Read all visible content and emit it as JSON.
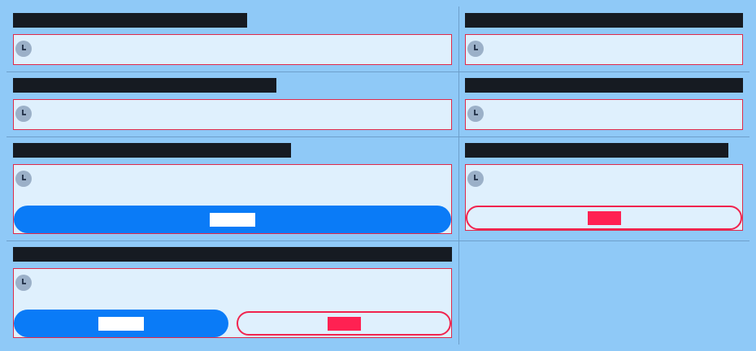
{
  "colors": {
    "background": "#8fc9f7",
    "title_bar": "#161b22",
    "field_bg": "#dff0fd",
    "field_border": "#e02a4a",
    "primary": "#0a7bf7",
    "danger": "#f0244f"
  },
  "icons": {
    "field_icon": "clock-icon"
  },
  "panels": [
    {
      "title": "",
      "value": "",
      "subvalue": ""
    },
    {
      "title": "",
      "value": "",
      "subvalue": ""
    },
    {
      "title": "",
      "value": "",
      "subvalue": ""
    },
    {
      "title": "",
      "value": "",
      "subvalue": ""
    },
    {
      "title": "",
      "value": "",
      "subvalue": "",
      "primary_label": ""
    },
    {
      "title": "",
      "value": "",
      "subvalue": "",
      "danger_label": ""
    },
    {
      "title": "",
      "value": "",
      "subvalue": "",
      "primary_label": "",
      "danger_label": ""
    }
  ]
}
